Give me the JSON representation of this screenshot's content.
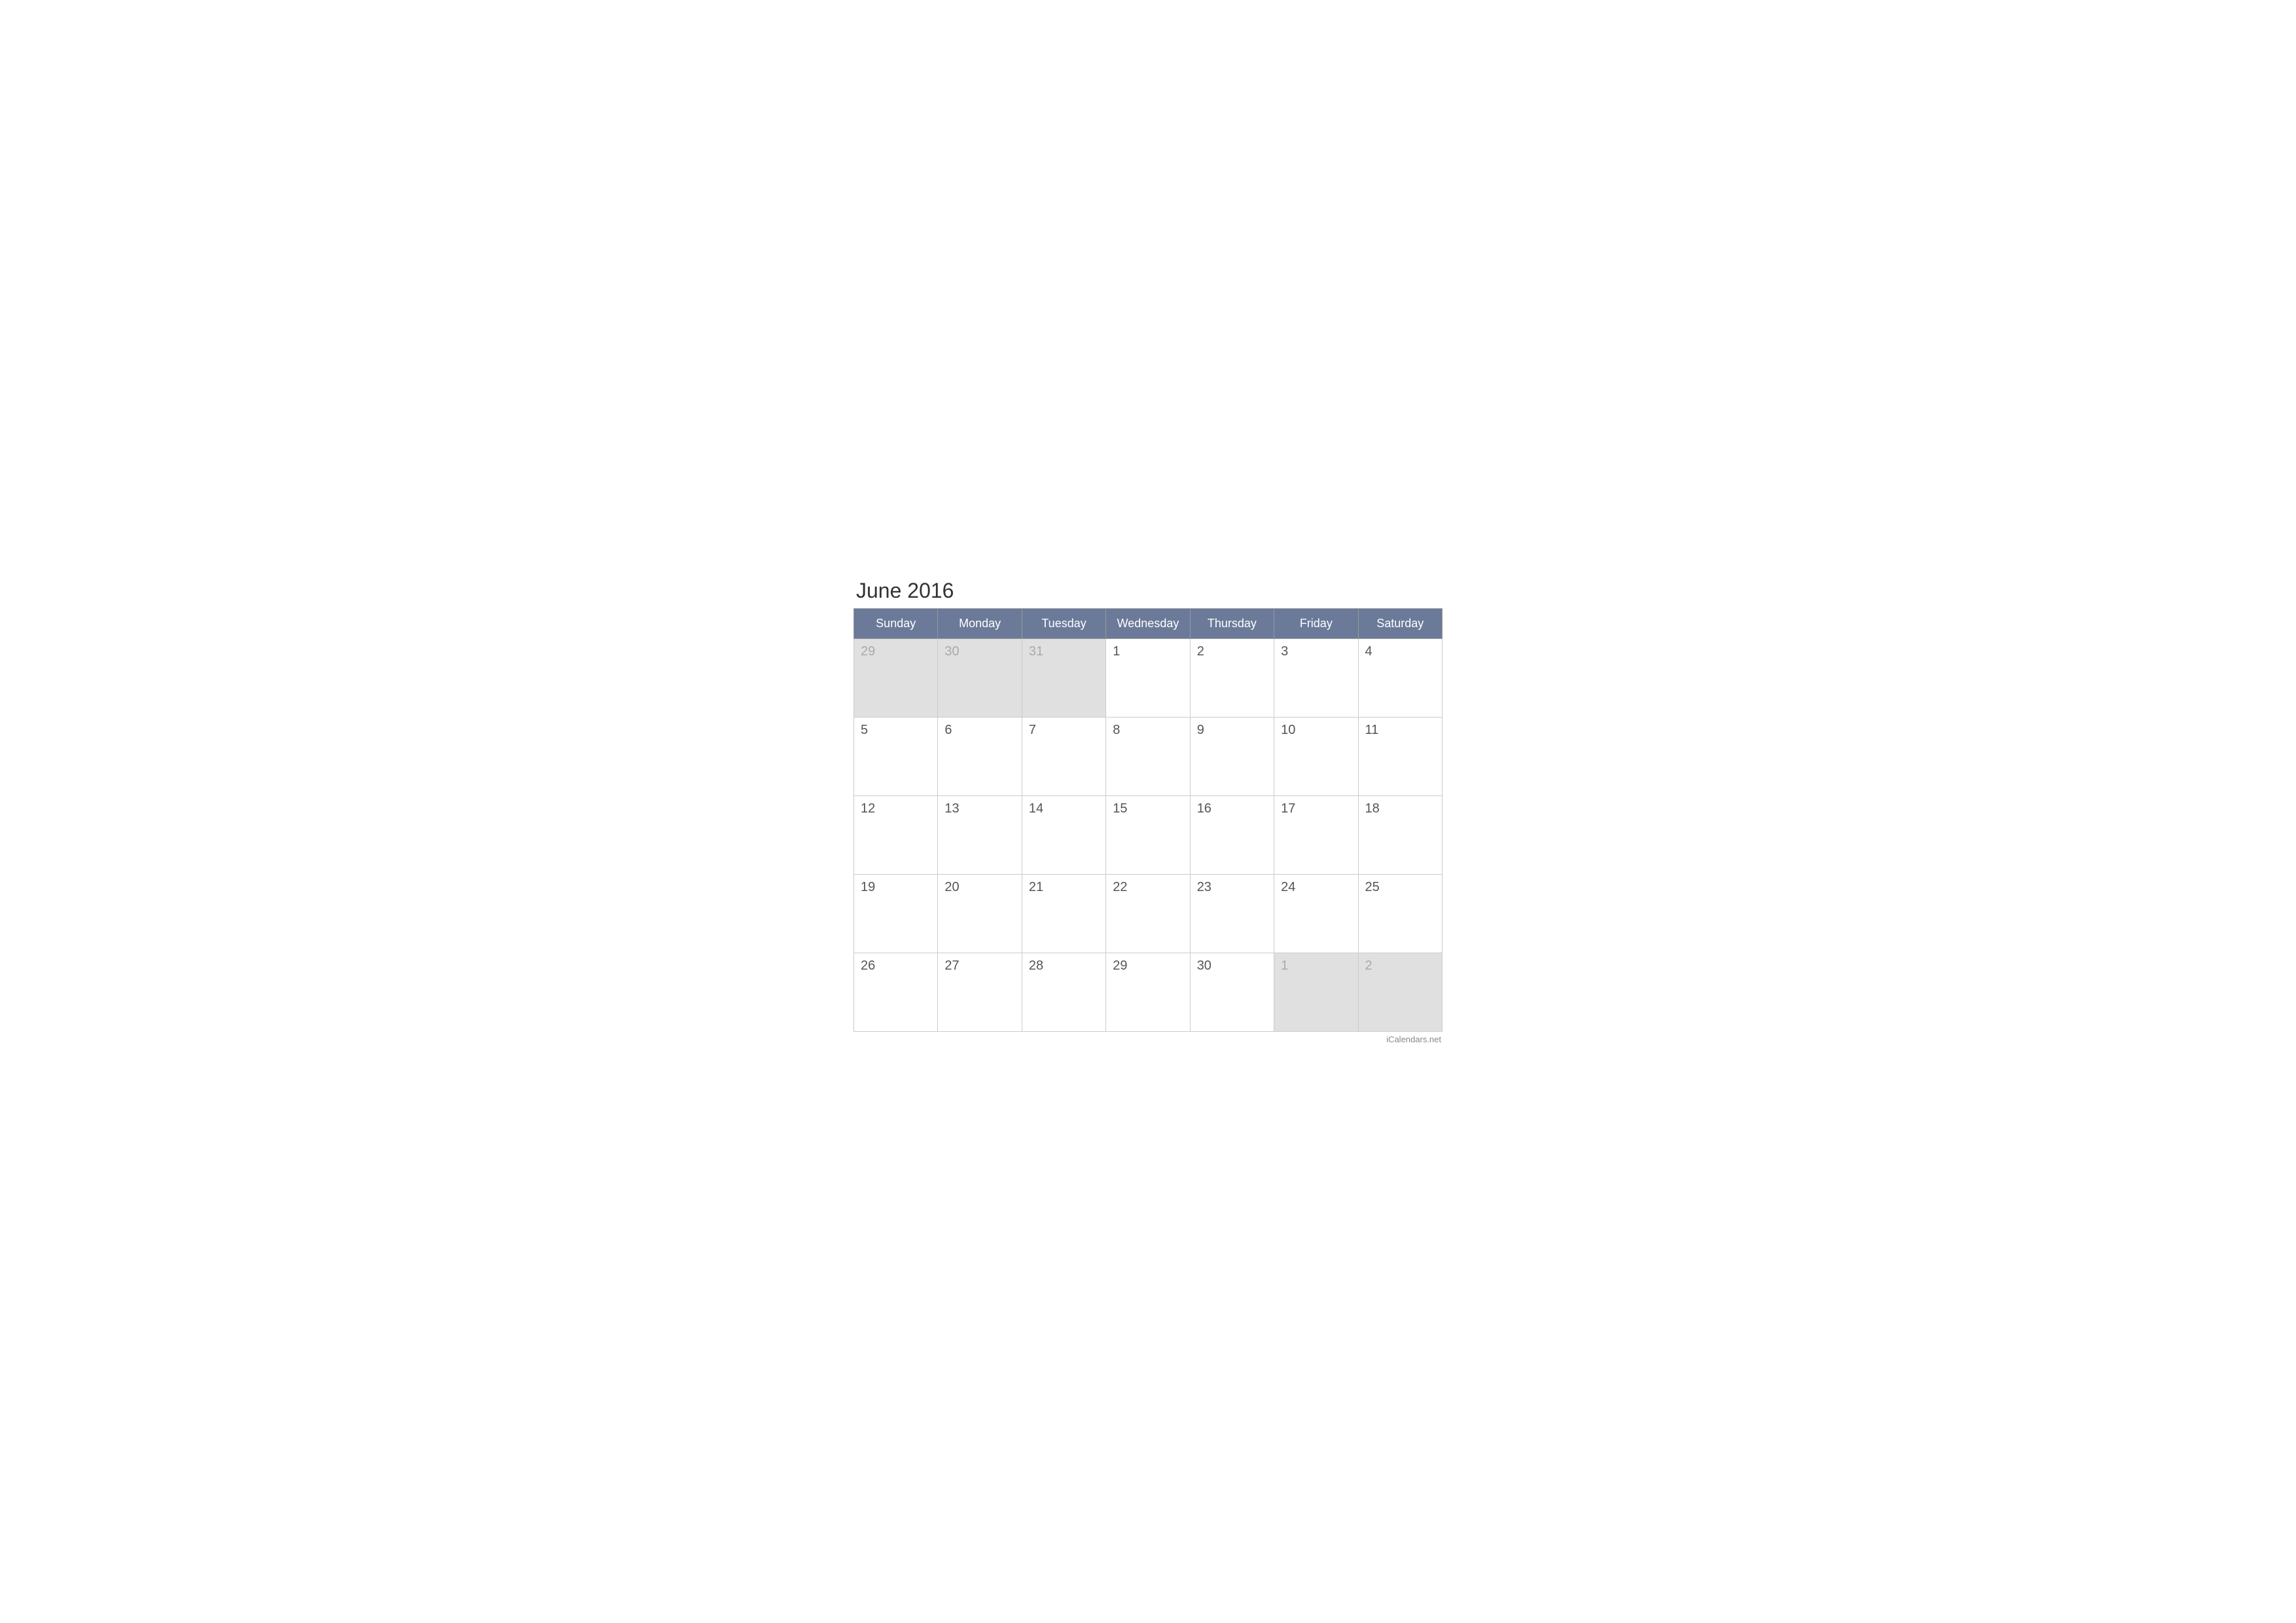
{
  "calendar": {
    "title": "June 2016",
    "headers": [
      "Sunday",
      "Monday",
      "Tuesday",
      "Wednesday",
      "Thursday",
      "Friday",
      "Saturday"
    ],
    "weeks": [
      [
        {
          "day": "29",
          "type": "other-month"
        },
        {
          "day": "30",
          "type": "other-month"
        },
        {
          "day": "31",
          "type": "other-month"
        },
        {
          "day": "1",
          "type": "current-month"
        },
        {
          "day": "2",
          "type": "current-month"
        },
        {
          "day": "3",
          "type": "current-month"
        },
        {
          "day": "4",
          "type": "current-month"
        }
      ],
      [
        {
          "day": "5",
          "type": "current-month"
        },
        {
          "day": "6",
          "type": "current-month"
        },
        {
          "day": "7",
          "type": "current-month"
        },
        {
          "day": "8",
          "type": "current-month"
        },
        {
          "day": "9",
          "type": "current-month"
        },
        {
          "day": "10",
          "type": "current-month"
        },
        {
          "day": "11",
          "type": "current-month"
        }
      ],
      [
        {
          "day": "12",
          "type": "current-month"
        },
        {
          "day": "13",
          "type": "current-month"
        },
        {
          "day": "14",
          "type": "current-month"
        },
        {
          "day": "15",
          "type": "current-month"
        },
        {
          "day": "16",
          "type": "current-month"
        },
        {
          "day": "17",
          "type": "current-month"
        },
        {
          "day": "18",
          "type": "current-month"
        }
      ],
      [
        {
          "day": "19",
          "type": "current-month"
        },
        {
          "day": "20",
          "type": "current-month"
        },
        {
          "day": "21",
          "type": "current-month"
        },
        {
          "day": "22",
          "type": "current-month"
        },
        {
          "day": "23",
          "type": "current-month"
        },
        {
          "day": "24",
          "type": "current-month"
        },
        {
          "day": "25",
          "type": "current-month"
        }
      ],
      [
        {
          "day": "26",
          "type": "current-month"
        },
        {
          "day": "27",
          "type": "current-month"
        },
        {
          "day": "28",
          "type": "current-month"
        },
        {
          "day": "29",
          "type": "current-month"
        },
        {
          "day": "30",
          "type": "current-month"
        },
        {
          "day": "1",
          "type": "other-month"
        },
        {
          "day": "2",
          "type": "other-month"
        }
      ]
    ],
    "watermark": "iCalendars.net"
  }
}
